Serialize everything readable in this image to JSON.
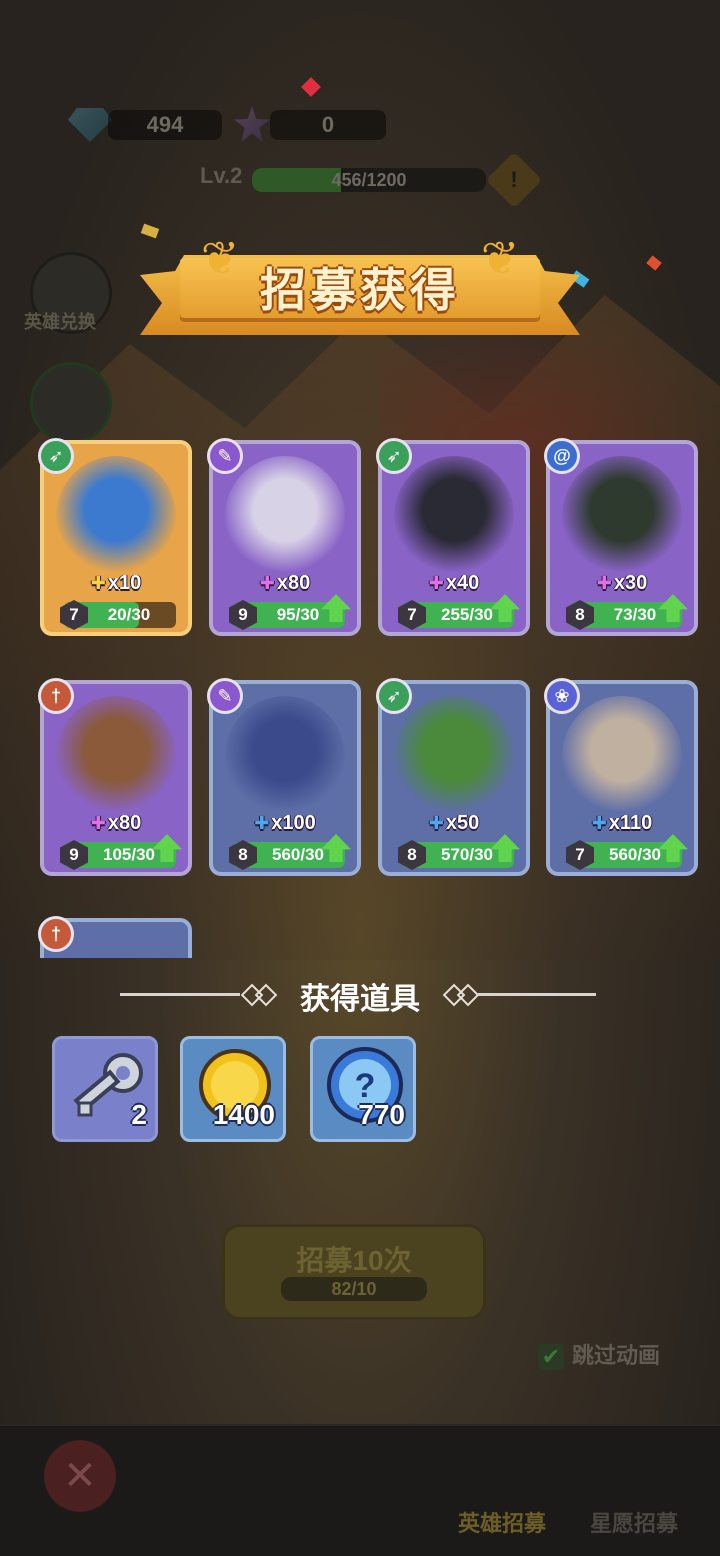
{
  "top": {
    "gems": "494",
    "stars": "0",
    "level_label": "Lv.2",
    "xp_text": "456/1200",
    "xp_fraction": 0.38,
    "warn_icon": "!"
  },
  "side": {
    "hero_exchange_label": "英雄兑换"
  },
  "banner": {
    "title": "招募获得"
  },
  "heroes": [
    {
      "class_icon": "bow-icon",
      "rarity": "gold",
      "pieces": "x10",
      "level": "7",
      "progress": "20/30",
      "fill": 0.67,
      "upgrade": false
    },
    {
      "class_icon": "staff-icon",
      "rarity": "purple",
      "pieces": "x80",
      "level": "9",
      "progress": "95/30",
      "fill": 1,
      "upgrade": true
    },
    {
      "class_icon": "bow-icon",
      "rarity": "purple",
      "pieces": "x40",
      "level": "7",
      "progress": "255/30",
      "fill": 1,
      "upgrade": true
    },
    {
      "class_icon": "swirl-icon",
      "rarity": "purple",
      "pieces": "x30",
      "level": "8",
      "progress": "73/30",
      "fill": 1,
      "upgrade": true
    },
    {
      "class_icon": "sword-icon",
      "rarity": "purple",
      "pieces": "x80",
      "level": "9",
      "progress": "105/30",
      "fill": 1,
      "upgrade": true
    },
    {
      "class_icon": "staff-icon",
      "rarity": "blue",
      "pieces": "x100",
      "level": "8",
      "progress": "560/30",
      "fill": 1,
      "upgrade": true
    },
    {
      "class_icon": "bow-icon",
      "rarity": "blue",
      "pieces": "x50",
      "level": "8",
      "progress": "570/30",
      "fill": 1,
      "upgrade": true
    },
    {
      "class_icon": "paw-icon",
      "rarity": "blue",
      "pieces": "x110",
      "level": "7",
      "progress": "560/30",
      "fill": 1,
      "upgrade": true
    }
  ],
  "items_section": {
    "title": "获得道具",
    "items": [
      {
        "icon": "key-icon",
        "count": "2"
      },
      {
        "icon": "gold-coin-icon",
        "count": "1400"
      },
      {
        "icon": "mystery-orb-icon",
        "count": "770"
      }
    ]
  },
  "recruit": {
    "label": "招募10次",
    "cost": "82/10"
  },
  "skip_label": "跳过动画",
  "nav": {
    "hero_recruit": "英雄招募",
    "wish_recruit": "星愿招募"
  },
  "colors": {
    "purple_card": "#8a63c7",
    "blue_card": "#5e6ea7",
    "gold_card": "#e8a448",
    "progress_green": "#40b252",
    "banner_gold": "#f0b233"
  }
}
